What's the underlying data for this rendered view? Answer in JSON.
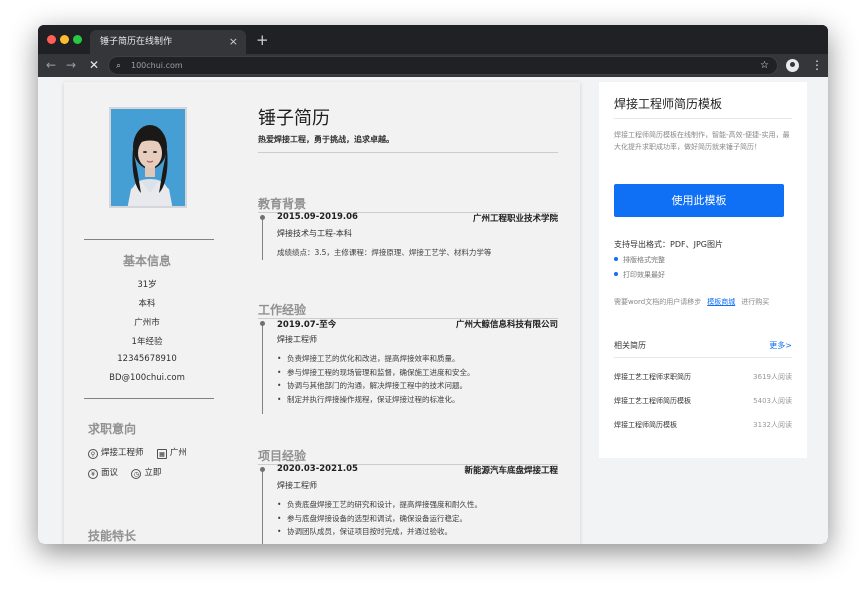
{
  "browser": {
    "tab_title": "锤子简历在线制作",
    "tab_close": "×",
    "new_tab": "+",
    "url": "100chui.com",
    "back": "←",
    "forward": "→",
    "stop": "✕",
    "search_glyph": "⌕",
    "star": "☆",
    "menu": "⋮"
  },
  "resume": {
    "name": "锤子简历",
    "motto": "热爱焊接工程，勇于挑战，追求卓越。",
    "basic_title": "基本信息",
    "basic": [
      "31岁",
      "本科",
      "广州市",
      "1年经验",
      "12345678910",
      "BD@100chui.com"
    ],
    "intent_title": "求职意向",
    "intent": {
      "position": "焊接工程师",
      "city": "广州",
      "salary": "面议",
      "availability": "立即"
    },
    "skills_title": "技能特长",
    "edu_title": "教育背景",
    "edu": {
      "date": "2015.09-2019.06",
      "school": "广州工程职业技术学院",
      "major": "焊接技术与工程-本科",
      "detail": "成绩绩点：3.5，主修课程：焊接原理、焊接工艺学、材料力学等"
    },
    "work_title": "工作经验",
    "work": {
      "date": "2019.07-至今",
      "company": "广州大鲸信息科技有限公司",
      "role": "焊接工程师",
      "bullets": [
        "负责焊接工艺的优化和改进，提高焊接效率和质量。",
        "参与焊接工程的现场管理和监督，确保施工进度和安全。",
        "协调与其他部门的沟通，解决焊接工程中的技术问题。",
        "制定并执行焊接操作规程，保证焊接过程的标准化。"
      ]
    },
    "proj_title": "项目经验",
    "proj": {
      "date": "2020.03-2021.05",
      "name": "新能源汽车底盘焊接工程",
      "role": "焊接工程师",
      "bullets": [
        "负责底盘焊接工艺的研究和设计，提高焊接强度和耐久性。",
        "参与底盘焊接设备的选型和调试，确保设备运行稳定。",
        "协调团队成员，保证项目按时完成，并通过验收。"
      ]
    }
  },
  "panel": {
    "title": "焊接工程师简历模板",
    "desc": "焊接工程师简历模板在线制作，智能-高效-便捷-实用，最大化提升求职成功率，做好简历就来锤子简历！",
    "use_button": "使用此模板",
    "formats": "支持导出格式：PDF、JPG图片",
    "features": [
      "排版格式完整",
      "打印效果最好"
    ],
    "word_note_pre": "需要word文档的用户请移步",
    "word_link": "模板商城",
    "word_note_post": "进行购买",
    "related_title": "相关简历",
    "more": "更多>",
    "related": [
      {
        "title": "焊接工艺工程师求职简历",
        "reads": "3619人阅读"
      },
      {
        "title": "焊接工艺工程师简历模板",
        "reads": "5403人阅读"
      },
      {
        "title": "焊接工程师简历模板",
        "reads": "3132人阅读"
      }
    ]
  }
}
